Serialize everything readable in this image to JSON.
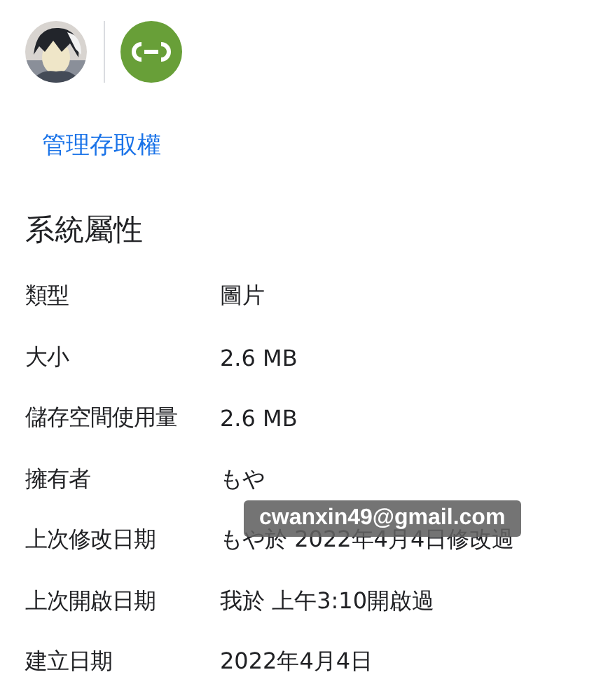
{
  "manage_access": "管理存取權",
  "section_title": "系統屬性",
  "properties": [
    {
      "label": "類型",
      "value": "圖片"
    },
    {
      "label": "大小",
      "value": "2.6 MB"
    },
    {
      "label": "儲存空間使用量",
      "value": "2.6 MB"
    },
    {
      "label": "擁有者",
      "value": "もや"
    },
    {
      "label": "上次修改日期",
      "value": "もや於 2022年4月4日修改過"
    },
    {
      "label": "上次開啟日期",
      "value": "我於 上午3:10開啟過"
    },
    {
      "label": "建立日期",
      "value": "2022年4月4日"
    }
  ],
  "tooltip": {
    "text": "cwanxin49@gmail.com"
  }
}
